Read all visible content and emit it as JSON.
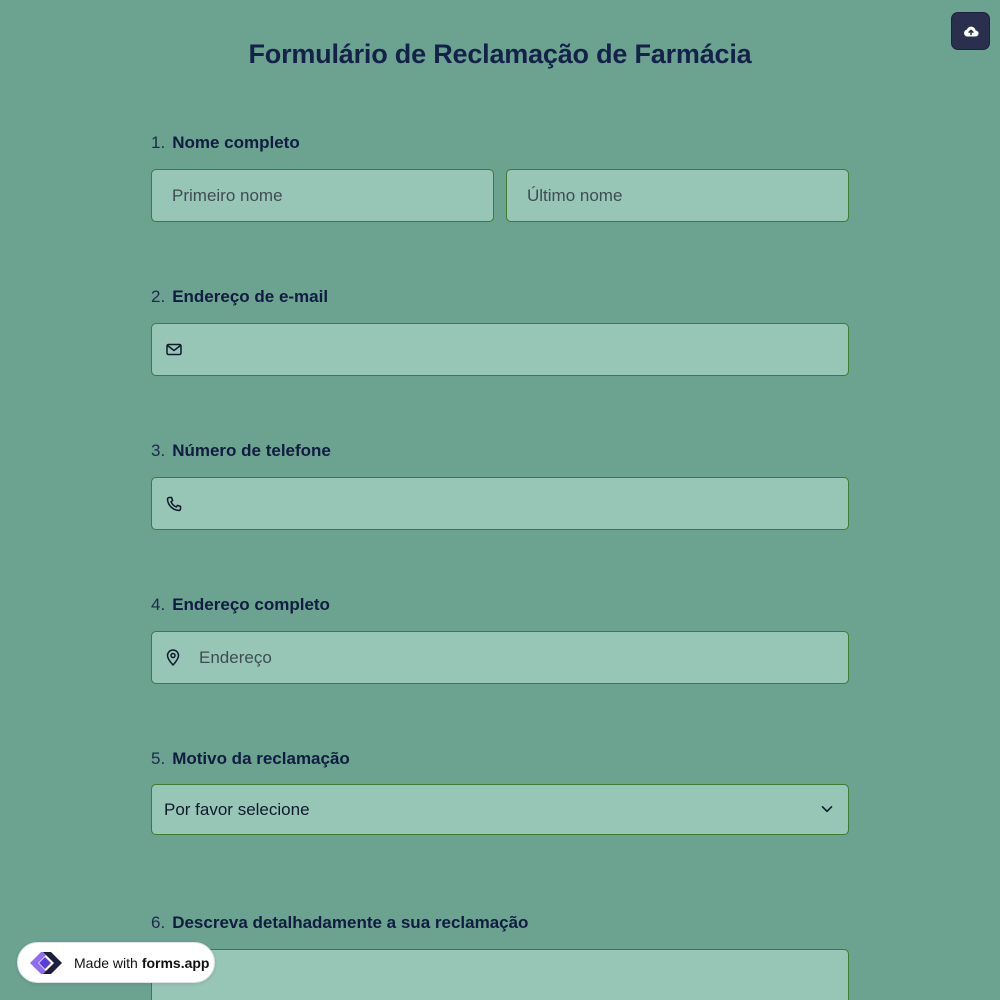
{
  "form": {
    "title": "Formulário de Reclamação de Farmácia"
  },
  "toolbar": {
    "upload_icon": "cloud-upload-icon"
  },
  "questions": [
    {
      "number": "1.",
      "label": "Nome completo",
      "first_placeholder": "Primeiro nome",
      "last_placeholder": "Último nome"
    },
    {
      "number": "2.",
      "label": "Endereço de e-mail",
      "icon": "mail-icon",
      "value": ""
    },
    {
      "number": "3.",
      "label": "Número de telefone",
      "icon": "phone-icon",
      "value": ""
    },
    {
      "number": "4.",
      "label": "Endereço completo",
      "icon": "map-pin-icon",
      "placeholder": "Endereço"
    },
    {
      "number": "5.",
      "label": "Motivo da reclamação",
      "selected": "Por favor selecione",
      "icon": "chevron-down-icon"
    },
    {
      "number": "6.",
      "label": "Descreva detalhadamente a sua reclamação",
      "value": ""
    }
  ],
  "badge": {
    "made_with": "Made with",
    "brand": "forms.app"
  },
  "colors": {
    "background": "#6ba290",
    "field_bg": "#97c5b6",
    "field_border": "#3e7d30",
    "title": "#14224a",
    "upload_button": "#2a2f4d"
  }
}
